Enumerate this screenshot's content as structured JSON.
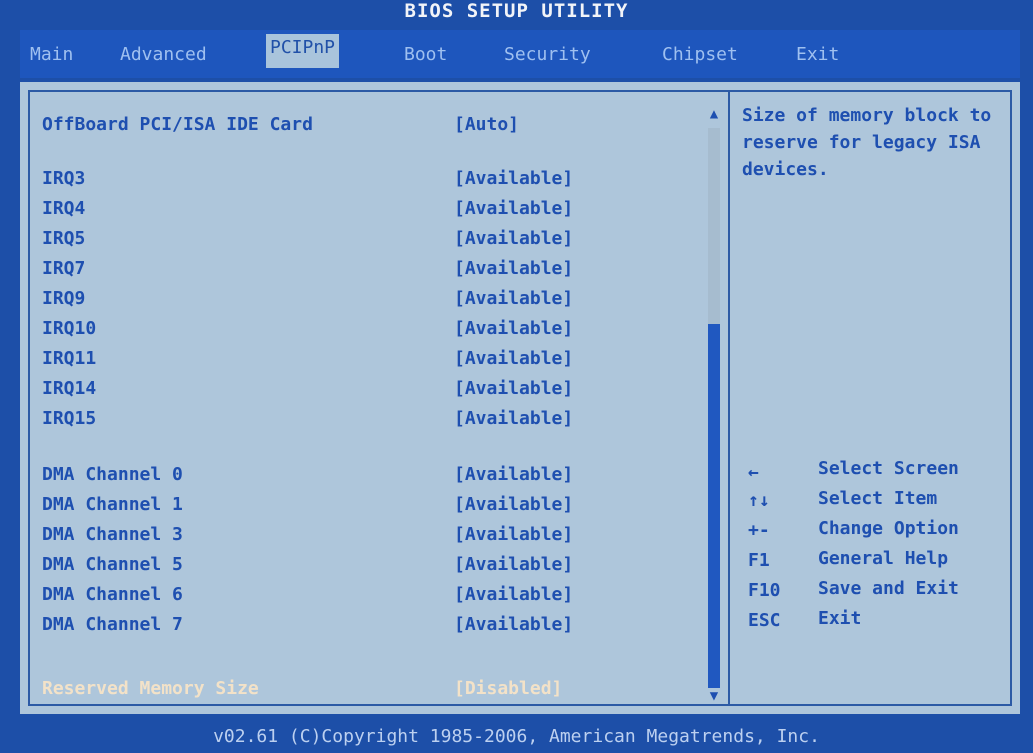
{
  "title": "BIOS SETUP UTILITY",
  "tabs": [
    "Main",
    "Advanced",
    "PCIPnP",
    "Boot",
    "Security",
    "Chipset",
    "Exit"
  ],
  "active_tab": "PCIPnP",
  "items": [
    {
      "label": "OffBoard PCI/ISA IDE Card",
      "value": "[Auto]"
    },
    {
      "label": "IRQ3",
      "value": "[Available]"
    },
    {
      "label": "IRQ4",
      "value": "[Available]"
    },
    {
      "label": "IRQ5",
      "value": "[Available]"
    },
    {
      "label": "IRQ7",
      "value": "[Available]"
    },
    {
      "label": "IRQ9",
      "value": "[Available]"
    },
    {
      "label": "IRQ10",
      "value": "[Available]"
    },
    {
      "label": "IRQ11",
      "value": "[Available]"
    },
    {
      "label": "IRQ14",
      "value": "[Available]"
    },
    {
      "label": "IRQ15",
      "value": "[Available]"
    },
    {
      "label": "DMA Channel 0",
      "value": "[Available]"
    },
    {
      "label": "DMA Channel 1",
      "value": "[Available]"
    },
    {
      "label": "DMA Channel 3",
      "value": "[Available]"
    },
    {
      "label": "DMA Channel 5",
      "value": "[Available]"
    },
    {
      "label": "DMA Channel 6",
      "value": "[Available]"
    },
    {
      "label": "DMA Channel 7",
      "value": "[Available]"
    },
    {
      "label": "Reserved Memory Size",
      "value": "[Disabled]"
    }
  ],
  "help_text": "Size of memory block to reserve for legacy ISA devices.",
  "keys": [
    {
      "key": "←",
      "desc": "Select Screen"
    },
    {
      "key": "↑↓",
      "desc": "Select Item"
    },
    {
      "key": "+-",
      "desc": "Change Option"
    },
    {
      "key": "F1",
      "desc": "General Help"
    },
    {
      "key": "F10",
      "desc": "Save and Exit"
    },
    {
      "key": "ESC",
      "desc": "Exit"
    }
  ],
  "footer": "v02.61 (C)Copyright 1985-2006, American Megatrends, Inc."
}
